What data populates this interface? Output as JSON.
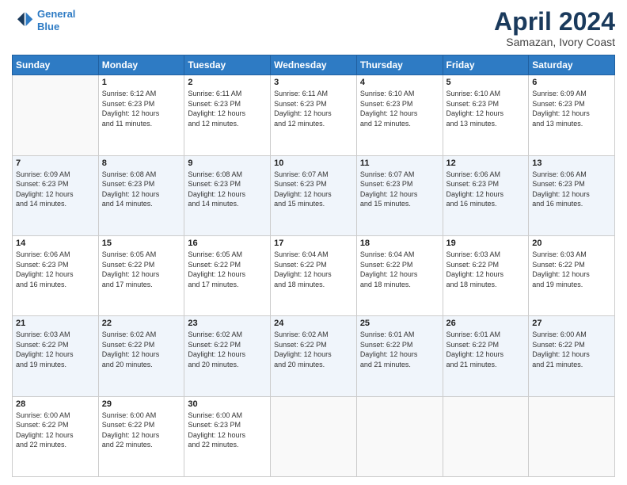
{
  "header": {
    "logo_line1": "General",
    "logo_line2": "Blue",
    "month_title": "April 2024",
    "subtitle": "Samazan, Ivory Coast"
  },
  "weekdays": [
    "Sunday",
    "Monday",
    "Tuesday",
    "Wednesday",
    "Thursday",
    "Friday",
    "Saturday"
  ],
  "weeks": [
    [
      {
        "day": "",
        "info": ""
      },
      {
        "day": "1",
        "info": "Sunrise: 6:12 AM\nSunset: 6:23 PM\nDaylight: 12 hours\nand 11 minutes."
      },
      {
        "day": "2",
        "info": "Sunrise: 6:11 AM\nSunset: 6:23 PM\nDaylight: 12 hours\nand 12 minutes."
      },
      {
        "day": "3",
        "info": "Sunrise: 6:11 AM\nSunset: 6:23 PM\nDaylight: 12 hours\nand 12 minutes."
      },
      {
        "day": "4",
        "info": "Sunrise: 6:10 AM\nSunset: 6:23 PM\nDaylight: 12 hours\nand 12 minutes."
      },
      {
        "day": "5",
        "info": "Sunrise: 6:10 AM\nSunset: 6:23 PM\nDaylight: 12 hours\nand 13 minutes."
      },
      {
        "day": "6",
        "info": "Sunrise: 6:09 AM\nSunset: 6:23 PM\nDaylight: 12 hours\nand 13 minutes."
      }
    ],
    [
      {
        "day": "7",
        "info": "Sunrise: 6:09 AM\nSunset: 6:23 PM\nDaylight: 12 hours\nand 14 minutes."
      },
      {
        "day": "8",
        "info": "Sunrise: 6:08 AM\nSunset: 6:23 PM\nDaylight: 12 hours\nand 14 minutes."
      },
      {
        "day": "9",
        "info": "Sunrise: 6:08 AM\nSunset: 6:23 PM\nDaylight: 12 hours\nand 14 minutes."
      },
      {
        "day": "10",
        "info": "Sunrise: 6:07 AM\nSunset: 6:23 PM\nDaylight: 12 hours\nand 15 minutes."
      },
      {
        "day": "11",
        "info": "Sunrise: 6:07 AM\nSunset: 6:23 PM\nDaylight: 12 hours\nand 15 minutes."
      },
      {
        "day": "12",
        "info": "Sunrise: 6:06 AM\nSunset: 6:23 PM\nDaylight: 12 hours\nand 16 minutes."
      },
      {
        "day": "13",
        "info": "Sunrise: 6:06 AM\nSunset: 6:23 PM\nDaylight: 12 hours\nand 16 minutes."
      }
    ],
    [
      {
        "day": "14",
        "info": "Sunrise: 6:06 AM\nSunset: 6:23 PM\nDaylight: 12 hours\nand 16 minutes."
      },
      {
        "day": "15",
        "info": "Sunrise: 6:05 AM\nSunset: 6:22 PM\nDaylight: 12 hours\nand 17 minutes."
      },
      {
        "day": "16",
        "info": "Sunrise: 6:05 AM\nSunset: 6:22 PM\nDaylight: 12 hours\nand 17 minutes."
      },
      {
        "day": "17",
        "info": "Sunrise: 6:04 AM\nSunset: 6:22 PM\nDaylight: 12 hours\nand 18 minutes."
      },
      {
        "day": "18",
        "info": "Sunrise: 6:04 AM\nSunset: 6:22 PM\nDaylight: 12 hours\nand 18 minutes."
      },
      {
        "day": "19",
        "info": "Sunrise: 6:03 AM\nSunset: 6:22 PM\nDaylight: 12 hours\nand 18 minutes."
      },
      {
        "day": "20",
        "info": "Sunrise: 6:03 AM\nSunset: 6:22 PM\nDaylight: 12 hours\nand 19 minutes."
      }
    ],
    [
      {
        "day": "21",
        "info": "Sunrise: 6:03 AM\nSunset: 6:22 PM\nDaylight: 12 hours\nand 19 minutes."
      },
      {
        "day": "22",
        "info": "Sunrise: 6:02 AM\nSunset: 6:22 PM\nDaylight: 12 hours\nand 20 minutes."
      },
      {
        "day": "23",
        "info": "Sunrise: 6:02 AM\nSunset: 6:22 PM\nDaylight: 12 hours\nand 20 minutes."
      },
      {
        "day": "24",
        "info": "Sunrise: 6:02 AM\nSunset: 6:22 PM\nDaylight: 12 hours\nand 20 minutes."
      },
      {
        "day": "25",
        "info": "Sunrise: 6:01 AM\nSunset: 6:22 PM\nDaylight: 12 hours\nand 21 minutes."
      },
      {
        "day": "26",
        "info": "Sunrise: 6:01 AM\nSunset: 6:22 PM\nDaylight: 12 hours\nand 21 minutes."
      },
      {
        "day": "27",
        "info": "Sunrise: 6:00 AM\nSunset: 6:22 PM\nDaylight: 12 hours\nand 21 minutes."
      }
    ],
    [
      {
        "day": "28",
        "info": "Sunrise: 6:00 AM\nSunset: 6:22 PM\nDaylight: 12 hours\nand 22 minutes."
      },
      {
        "day": "29",
        "info": "Sunrise: 6:00 AM\nSunset: 6:22 PM\nDaylight: 12 hours\nand 22 minutes."
      },
      {
        "day": "30",
        "info": "Sunrise: 6:00 AM\nSunset: 6:23 PM\nDaylight: 12 hours\nand 22 minutes."
      },
      {
        "day": "",
        "info": ""
      },
      {
        "day": "",
        "info": ""
      },
      {
        "day": "",
        "info": ""
      },
      {
        "day": "",
        "info": ""
      }
    ]
  ]
}
